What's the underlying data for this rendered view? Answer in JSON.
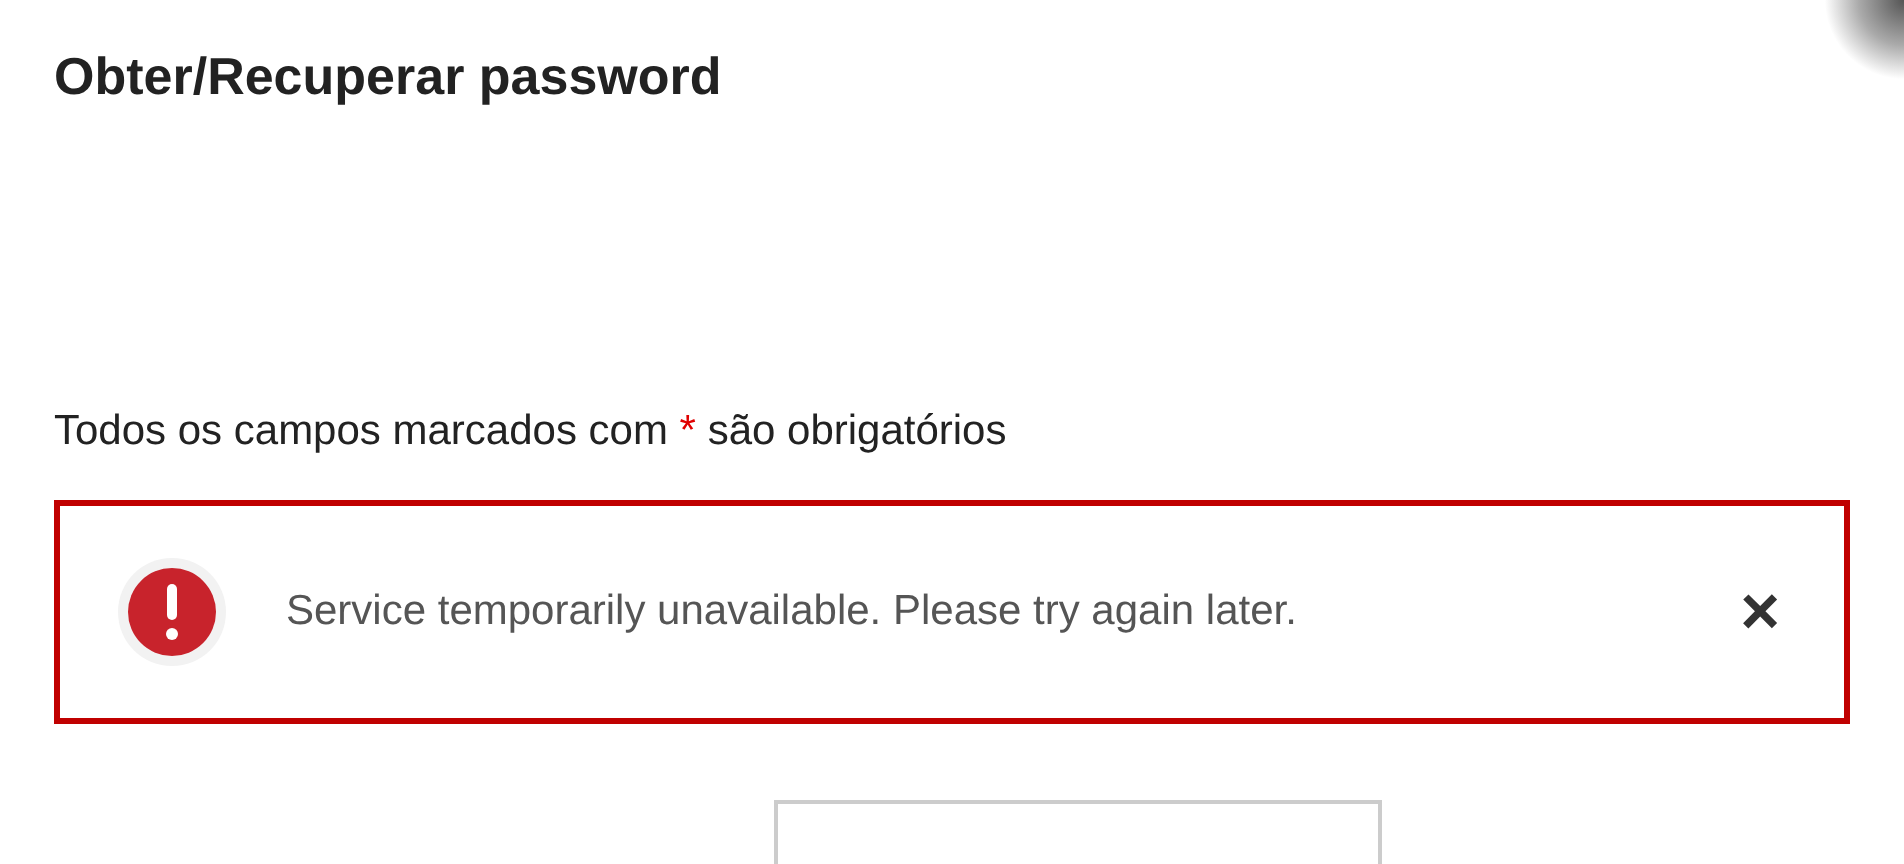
{
  "title": "Obter/Recuperar password",
  "required_note": {
    "before": "Todos os campos marcados com",
    "marker": "*",
    "after": "são obrigatórios"
  },
  "alert": {
    "kind": "error",
    "message": "Service temporarily unavailable. Please try again later.",
    "close": "×"
  }
}
